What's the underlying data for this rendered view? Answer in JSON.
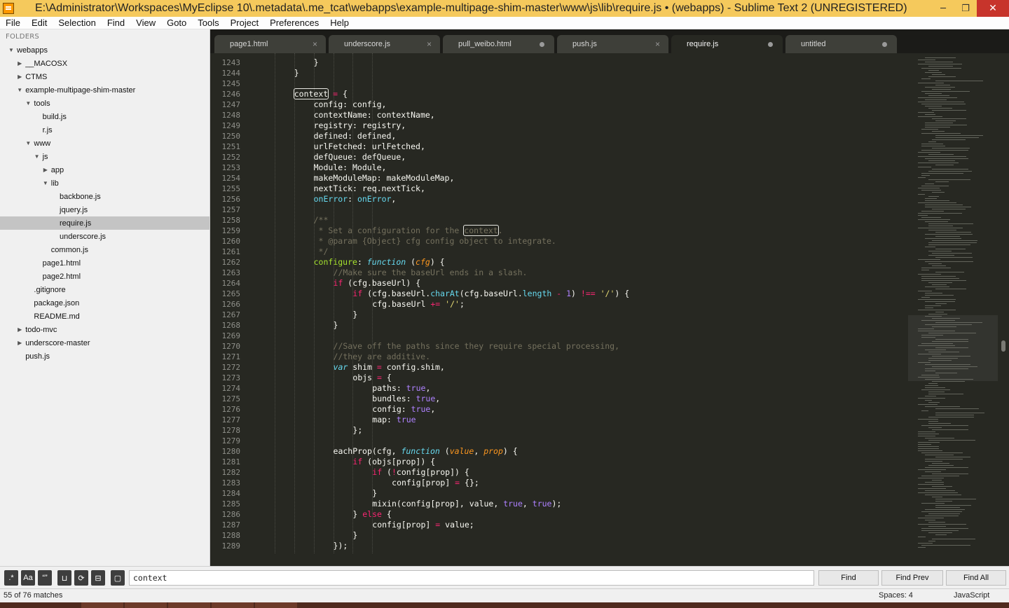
{
  "window": {
    "title": "E:\\Administrator\\Workspaces\\MyEclipse 10\\.metadata\\.me_tcat\\webapps\\example-multipage-shim-master\\www\\js\\lib\\require.js • (webapps) - Sublime Text 2 (UNREGISTERED)",
    "minimize_glyph": "─",
    "restore_glyph": "❐",
    "close_glyph": "✕"
  },
  "menu": [
    "File",
    "Edit",
    "Selection",
    "Find",
    "View",
    "Goto",
    "Tools",
    "Project",
    "Preferences",
    "Help"
  ],
  "sidebar": {
    "header": "FOLDERS",
    "items": [
      {
        "label": "webapps",
        "depth": 0,
        "toggle": "open",
        "selected": false
      },
      {
        "label": "__MACOSX",
        "depth": 1,
        "toggle": "closed",
        "selected": false
      },
      {
        "label": "CTMS",
        "depth": 1,
        "toggle": "closed",
        "selected": false
      },
      {
        "label": "example-multipage-shim-master",
        "depth": 1,
        "toggle": "open",
        "selected": false
      },
      {
        "label": "tools",
        "depth": 2,
        "toggle": "open",
        "selected": false
      },
      {
        "label": "build.js",
        "depth": 3,
        "toggle": "none",
        "selected": false
      },
      {
        "label": "r.js",
        "depth": 3,
        "toggle": "none",
        "selected": false
      },
      {
        "label": "www",
        "depth": 2,
        "toggle": "open",
        "selected": false
      },
      {
        "label": "js",
        "depth": 3,
        "toggle": "open",
        "selected": false
      },
      {
        "label": "app",
        "depth": 4,
        "toggle": "closed",
        "selected": false
      },
      {
        "label": "lib",
        "depth": 4,
        "toggle": "open",
        "selected": false
      },
      {
        "label": "backbone.js",
        "depth": 5,
        "toggle": "none",
        "selected": false
      },
      {
        "label": "jquery.js",
        "depth": 5,
        "toggle": "none",
        "selected": false
      },
      {
        "label": "require.js",
        "depth": 5,
        "toggle": "none",
        "selected": true
      },
      {
        "label": "underscore.js",
        "depth": 5,
        "toggle": "none",
        "selected": false
      },
      {
        "label": "common.js",
        "depth": 4,
        "toggle": "none",
        "selected": false
      },
      {
        "label": "page1.html",
        "depth": 3,
        "toggle": "none",
        "selected": false
      },
      {
        "label": "page2.html",
        "depth": 3,
        "toggle": "none",
        "selected": false
      },
      {
        "label": ".gitignore",
        "depth": 2,
        "toggle": "none",
        "selected": false
      },
      {
        "label": "package.json",
        "depth": 2,
        "toggle": "none",
        "selected": false
      },
      {
        "label": "README.md",
        "depth": 2,
        "toggle": "none",
        "selected": false
      },
      {
        "label": "todo-mvc",
        "depth": 1,
        "toggle": "closed",
        "selected": false
      },
      {
        "label": "underscore-master",
        "depth": 1,
        "toggle": "closed",
        "selected": false
      },
      {
        "label": "push.js",
        "depth": 1,
        "toggle": "none",
        "selected": false
      }
    ]
  },
  "tabs": [
    {
      "label": "page1.html",
      "mark": "close",
      "active": false
    },
    {
      "label": "underscore.js",
      "mark": "close",
      "active": false
    },
    {
      "label": "pull_weibo.html",
      "mark": "dirty",
      "active": false
    },
    {
      "label": "push.js",
      "mark": "close",
      "active": false
    },
    {
      "label": "require.js",
      "mark": "dirty",
      "active": true
    },
    {
      "label": "untitled",
      "mark": "dirty",
      "active": false
    }
  ],
  "editor": {
    "language": "javascript",
    "first_line": 1243,
    "lines": [
      [
        [
          "}",
          ""
        ]
      ],
      [
        [
          "}",
          ""
        ]
      ],
      [],
      [
        [
          "context",
          "hl"
        ],
        [
          " ",
          ""
        ],
        [
          "=",
          "kw"
        ],
        [
          " {",
          ""
        ]
      ],
      [
        [
          "config: config,",
          ""
        ]
      ],
      [
        [
          "contextName: contextName,",
          ""
        ]
      ],
      [
        [
          "registry: registry,",
          ""
        ]
      ],
      [
        [
          "defined: defined,",
          ""
        ]
      ],
      [
        [
          "urlFetched: urlFetched,",
          ""
        ]
      ],
      [
        [
          "defQueue: defQueue,",
          ""
        ]
      ],
      [
        [
          "Module: Module,",
          ""
        ]
      ],
      [
        [
          "makeModuleMap: makeModuleMap,",
          ""
        ]
      ],
      [
        [
          "nextTick: req.nextTick,",
          ""
        ]
      ],
      [
        [
          "onError",
          "pp"
        ],
        [
          ": ",
          ""
        ],
        [
          "onError",
          "pp"
        ],
        [
          ",",
          ""
        ]
      ],
      [],
      [
        [
          "/**",
          "cm"
        ]
      ],
      [
        [
          " * Set a configuration for the ",
          "cm"
        ],
        [
          "context",
          "hlcm"
        ],
        [
          ".",
          "cm"
        ]
      ],
      [
        [
          " * @param {Object} cfg config object to integrate.",
          "cm"
        ]
      ],
      [
        [
          " */",
          "cm"
        ]
      ],
      [
        [
          "configure",
          "fn"
        ],
        [
          ": ",
          ""
        ],
        [
          "function",
          "st"
        ],
        [
          " (",
          ""
        ],
        [
          "cfg",
          "pa"
        ],
        [
          ") {",
          ""
        ]
      ],
      [
        [
          "//Make sure the baseUrl ends in a slash.",
          "cm"
        ]
      ],
      [
        [
          "if",
          "kw"
        ],
        [
          " (cfg.baseUrl) {",
          ""
        ]
      ],
      [
        [
          "if",
          "kw"
        ],
        [
          " (cfg.baseUrl.",
          ""
        ],
        [
          "charAt",
          "pp"
        ],
        [
          "(cfg.baseUrl.",
          ""
        ],
        [
          "length",
          "pp"
        ],
        [
          " ",
          ""
        ],
        [
          "-",
          "kw"
        ],
        [
          " ",
          ""
        ],
        [
          "1",
          "nm"
        ],
        [
          ") ",
          ""
        ],
        [
          "!==",
          "kw"
        ],
        [
          " ",
          ""
        ],
        [
          "'/'",
          "sr"
        ],
        [
          ") {",
          ""
        ]
      ],
      [
        [
          "cfg.baseUrl ",
          ""
        ],
        [
          "+=",
          "kw"
        ],
        [
          " ",
          ""
        ],
        [
          "'/'",
          "sr"
        ],
        [
          ";",
          ""
        ]
      ],
      [
        [
          "}",
          ""
        ]
      ],
      [
        [
          "}",
          ""
        ]
      ],
      [],
      [
        [
          "//Save off the paths since they require special processing,",
          "cm"
        ]
      ],
      [
        [
          "//they are additive.",
          "cm"
        ]
      ],
      [
        [
          "var",
          "st"
        ],
        [
          " shim ",
          ""
        ],
        [
          "=",
          "kw"
        ],
        [
          " config.shim,",
          ""
        ]
      ],
      [
        [
          "objs ",
          ""
        ],
        [
          "=",
          "kw"
        ],
        [
          " {",
          ""
        ]
      ],
      [
        [
          "paths: ",
          ""
        ],
        [
          "true",
          "nm"
        ],
        [
          ",",
          ""
        ]
      ],
      [
        [
          "bundles: ",
          ""
        ],
        [
          "true",
          "nm"
        ],
        [
          ",",
          ""
        ]
      ],
      [
        [
          "config: ",
          ""
        ],
        [
          "true",
          "nm"
        ],
        [
          ",",
          ""
        ]
      ],
      [
        [
          "map: ",
          ""
        ],
        [
          "true",
          "nm"
        ]
      ],
      [
        [
          "};",
          ""
        ]
      ],
      [],
      [
        [
          "eachProp(cfg, ",
          ""
        ],
        [
          "function",
          "st"
        ],
        [
          " (",
          ""
        ],
        [
          "value",
          "pa"
        ],
        [
          ", ",
          ""
        ],
        [
          "prop",
          "pa"
        ],
        [
          ") {",
          ""
        ]
      ],
      [
        [
          "if",
          "kw"
        ],
        [
          " (objs[prop]) {",
          ""
        ]
      ],
      [
        [
          "if",
          "kw"
        ],
        [
          " (",
          ""
        ],
        [
          "!",
          "kw"
        ],
        [
          "config[prop]) {",
          ""
        ]
      ],
      [
        [
          "config[prop] ",
          ""
        ],
        [
          "=",
          "kw"
        ],
        [
          " {};",
          ""
        ]
      ],
      [
        [
          "}",
          ""
        ]
      ],
      [
        [
          "mixin(config[prop], value, ",
          ""
        ],
        [
          "true",
          "nm"
        ],
        [
          ", ",
          ""
        ],
        [
          "true",
          "nm"
        ],
        [
          ");",
          ""
        ]
      ],
      [
        [
          "} ",
          ""
        ],
        [
          "else",
          "kw"
        ],
        [
          " {",
          ""
        ]
      ],
      [
        [
          "config[prop] ",
          ""
        ],
        [
          "=",
          "kw"
        ],
        [
          " value;",
          ""
        ]
      ],
      [
        [
          "}",
          ""
        ]
      ],
      [
        [
          "});",
          ""
        ]
      ]
    ],
    "indents": [
      3,
      2,
      0,
      2,
      3,
      3,
      3,
      3,
      3,
      3,
      3,
      3,
      3,
      3,
      0,
      3,
      3,
      3,
      3,
      3,
      4,
      4,
      5,
      6,
      5,
      4,
      0,
      4,
      4,
      4,
      5,
      6,
      6,
      6,
      6,
      5,
      0,
      4,
      5,
      6,
      7,
      6,
      6,
      5,
      6,
      5,
      4
    ]
  },
  "find_panel": {
    "toggles": [
      "regex",
      "case-sensitive",
      "whole-word",
      "reverse",
      "wrap",
      "in-selection",
      "highlight-matches"
    ],
    "toggle_glyphs": [
      ".*",
      "Aa",
      "“”",
      "⊔",
      "⟳",
      "⊟",
      "▢"
    ],
    "query": "context",
    "buttons": [
      "Find",
      "Find Prev",
      "Find All"
    ]
  },
  "status": {
    "matches": "55 of 76 matches",
    "spaces": "Spaces: 4",
    "syntax": "JavaScript"
  },
  "colors": {
    "title_bar": "#f5c95c",
    "editor_bg": "#272822",
    "keyword": "#f92672",
    "storage": "#66d9ef",
    "param": "#fd971f",
    "function": "#a6e22e",
    "comment": "#75715e",
    "number": "#ae81ff",
    "string": "#e6db74"
  }
}
